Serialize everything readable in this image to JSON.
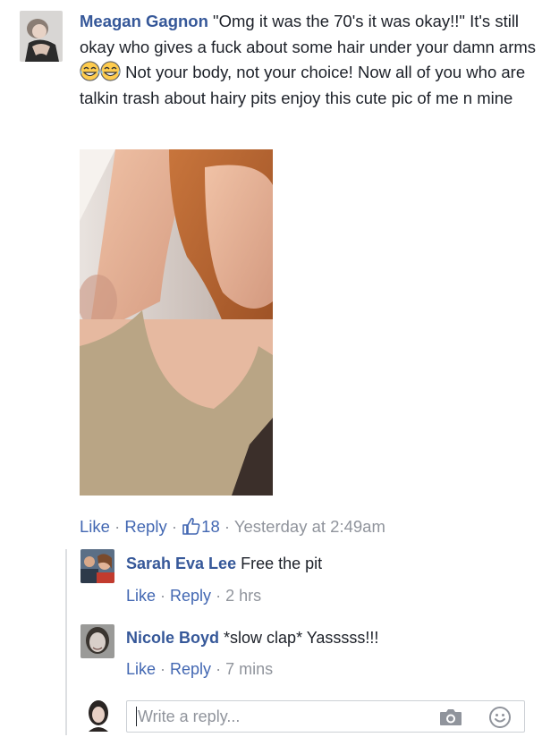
{
  "main_comment": {
    "author": "Meagan Gagnon",
    "text_part1": " \"Omg it was the 70's it was okay!!\" It's still okay who gives a fuck about some hair under your damn arms ",
    "text_part2": " Not your body, not your choice! Now all of you who are talkin trash about hairy pits enjoy this cute pic of me n mine",
    "emojis": [
      "tears-of-joy-emoji",
      "tears-of-joy-emoji"
    ],
    "actions": {
      "like": "Like",
      "reply": "Reply",
      "separator": " · ",
      "like_count": "18",
      "timestamp": "Yesterday at 2:49am"
    }
  },
  "replies": [
    {
      "author": "Sarah Eva Lee",
      "text": " Free the pit",
      "like": "Like",
      "reply": "Reply",
      "time": "2 hrs"
    },
    {
      "author": "Nicole Boyd",
      "text": " *slow clap* Yasssss!!!",
      "like": "Like",
      "reply": "Reply",
      "time": "7 mins"
    }
  ],
  "reply_box": {
    "placeholder": "Write a reply...",
    "icons": [
      "camera-icon",
      "smiley-icon"
    ]
  },
  "colors": {
    "name": "#365899",
    "link": "#4267b2",
    "muted": "#90949c",
    "text": "#1d2129"
  }
}
